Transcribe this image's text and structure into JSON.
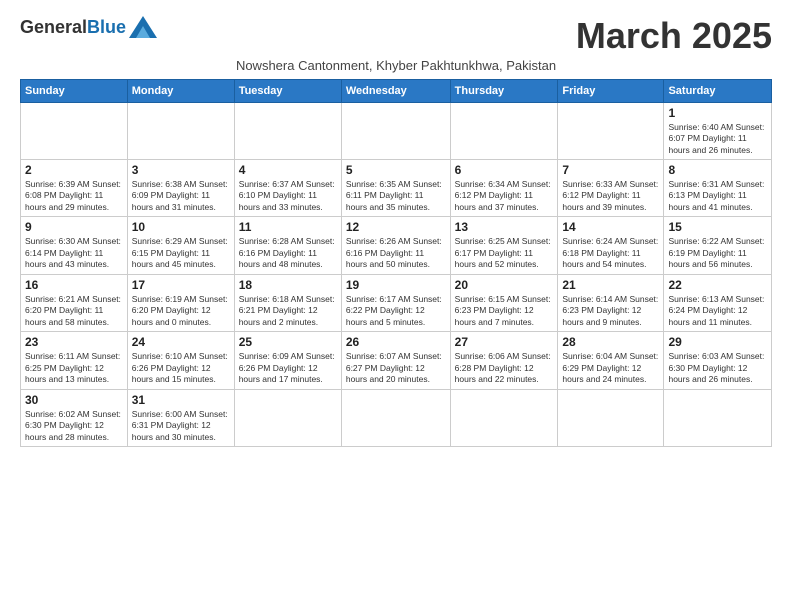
{
  "header": {
    "logo_general": "General",
    "logo_blue": "Blue",
    "month_title": "March 2025",
    "subtitle": "Nowshera Cantonment, Khyber Pakhtunkhwa, Pakistan"
  },
  "weekdays": [
    "Sunday",
    "Monday",
    "Tuesday",
    "Wednesday",
    "Thursday",
    "Friday",
    "Saturday"
  ],
  "weeks": [
    [
      {
        "day": "",
        "info": ""
      },
      {
        "day": "",
        "info": ""
      },
      {
        "day": "",
        "info": ""
      },
      {
        "day": "",
        "info": ""
      },
      {
        "day": "",
        "info": ""
      },
      {
        "day": "",
        "info": ""
      },
      {
        "day": "1",
        "info": "Sunrise: 6:40 AM\nSunset: 6:07 PM\nDaylight: 11 hours and 26 minutes."
      }
    ],
    [
      {
        "day": "2",
        "info": "Sunrise: 6:39 AM\nSunset: 6:08 PM\nDaylight: 11 hours and 29 minutes."
      },
      {
        "day": "3",
        "info": "Sunrise: 6:38 AM\nSunset: 6:09 PM\nDaylight: 11 hours and 31 minutes."
      },
      {
        "day": "4",
        "info": "Sunrise: 6:37 AM\nSunset: 6:10 PM\nDaylight: 11 hours and 33 minutes."
      },
      {
        "day": "5",
        "info": "Sunrise: 6:35 AM\nSunset: 6:11 PM\nDaylight: 11 hours and 35 minutes."
      },
      {
        "day": "6",
        "info": "Sunrise: 6:34 AM\nSunset: 6:12 PM\nDaylight: 11 hours and 37 minutes."
      },
      {
        "day": "7",
        "info": "Sunrise: 6:33 AM\nSunset: 6:12 PM\nDaylight: 11 hours and 39 minutes."
      },
      {
        "day": "8",
        "info": "Sunrise: 6:31 AM\nSunset: 6:13 PM\nDaylight: 11 hours and 41 minutes."
      }
    ],
    [
      {
        "day": "9",
        "info": "Sunrise: 6:30 AM\nSunset: 6:14 PM\nDaylight: 11 hours and 43 minutes."
      },
      {
        "day": "10",
        "info": "Sunrise: 6:29 AM\nSunset: 6:15 PM\nDaylight: 11 hours and 45 minutes."
      },
      {
        "day": "11",
        "info": "Sunrise: 6:28 AM\nSunset: 6:16 PM\nDaylight: 11 hours and 48 minutes."
      },
      {
        "day": "12",
        "info": "Sunrise: 6:26 AM\nSunset: 6:16 PM\nDaylight: 11 hours and 50 minutes."
      },
      {
        "day": "13",
        "info": "Sunrise: 6:25 AM\nSunset: 6:17 PM\nDaylight: 11 hours and 52 minutes."
      },
      {
        "day": "14",
        "info": "Sunrise: 6:24 AM\nSunset: 6:18 PM\nDaylight: 11 hours and 54 minutes."
      },
      {
        "day": "15",
        "info": "Sunrise: 6:22 AM\nSunset: 6:19 PM\nDaylight: 11 hours and 56 minutes."
      }
    ],
    [
      {
        "day": "16",
        "info": "Sunrise: 6:21 AM\nSunset: 6:20 PM\nDaylight: 11 hours and 58 minutes."
      },
      {
        "day": "17",
        "info": "Sunrise: 6:19 AM\nSunset: 6:20 PM\nDaylight: 12 hours and 0 minutes."
      },
      {
        "day": "18",
        "info": "Sunrise: 6:18 AM\nSunset: 6:21 PM\nDaylight: 12 hours and 2 minutes."
      },
      {
        "day": "19",
        "info": "Sunrise: 6:17 AM\nSunset: 6:22 PM\nDaylight: 12 hours and 5 minutes."
      },
      {
        "day": "20",
        "info": "Sunrise: 6:15 AM\nSunset: 6:23 PM\nDaylight: 12 hours and 7 minutes."
      },
      {
        "day": "21",
        "info": "Sunrise: 6:14 AM\nSunset: 6:23 PM\nDaylight: 12 hours and 9 minutes."
      },
      {
        "day": "22",
        "info": "Sunrise: 6:13 AM\nSunset: 6:24 PM\nDaylight: 12 hours and 11 minutes."
      }
    ],
    [
      {
        "day": "23",
        "info": "Sunrise: 6:11 AM\nSunset: 6:25 PM\nDaylight: 12 hours and 13 minutes."
      },
      {
        "day": "24",
        "info": "Sunrise: 6:10 AM\nSunset: 6:26 PM\nDaylight: 12 hours and 15 minutes."
      },
      {
        "day": "25",
        "info": "Sunrise: 6:09 AM\nSunset: 6:26 PM\nDaylight: 12 hours and 17 minutes."
      },
      {
        "day": "26",
        "info": "Sunrise: 6:07 AM\nSunset: 6:27 PM\nDaylight: 12 hours and 20 minutes."
      },
      {
        "day": "27",
        "info": "Sunrise: 6:06 AM\nSunset: 6:28 PM\nDaylight: 12 hours and 22 minutes."
      },
      {
        "day": "28",
        "info": "Sunrise: 6:04 AM\nSunset: 6:29 PM\nDaylight: 12 hours and 24 minutes."
      },
      {
        "day": "29",
        "info": "Sunrise: 6:03 AM\nSunset: 6:30 PM\nDaylight: 12 hours and 26 minutes."
      }
    ],
    [
      {
        "day": "30",
        "info": "Sunrise: 6:02 AM\nSunset: 6:30 PM\nDaylight: 12 hours and 28 minutes."
      },
      {
        "day": "31",
        "info": "Sunrise: 6:00 AM\nSunset: 6:31 PM\nDaylight: 12 hours and 30 minutes."
      },
      {
        "day": "",
        "info": ""
      },
      {
        "day": "",
        "info": ""
      },
      {
        "day": "",
        "info": ""
      },
      {
        "day": "",
        "info": ""
      },
      {
        "day": "",
        "info": ""
      }
    ]
  ]
}
